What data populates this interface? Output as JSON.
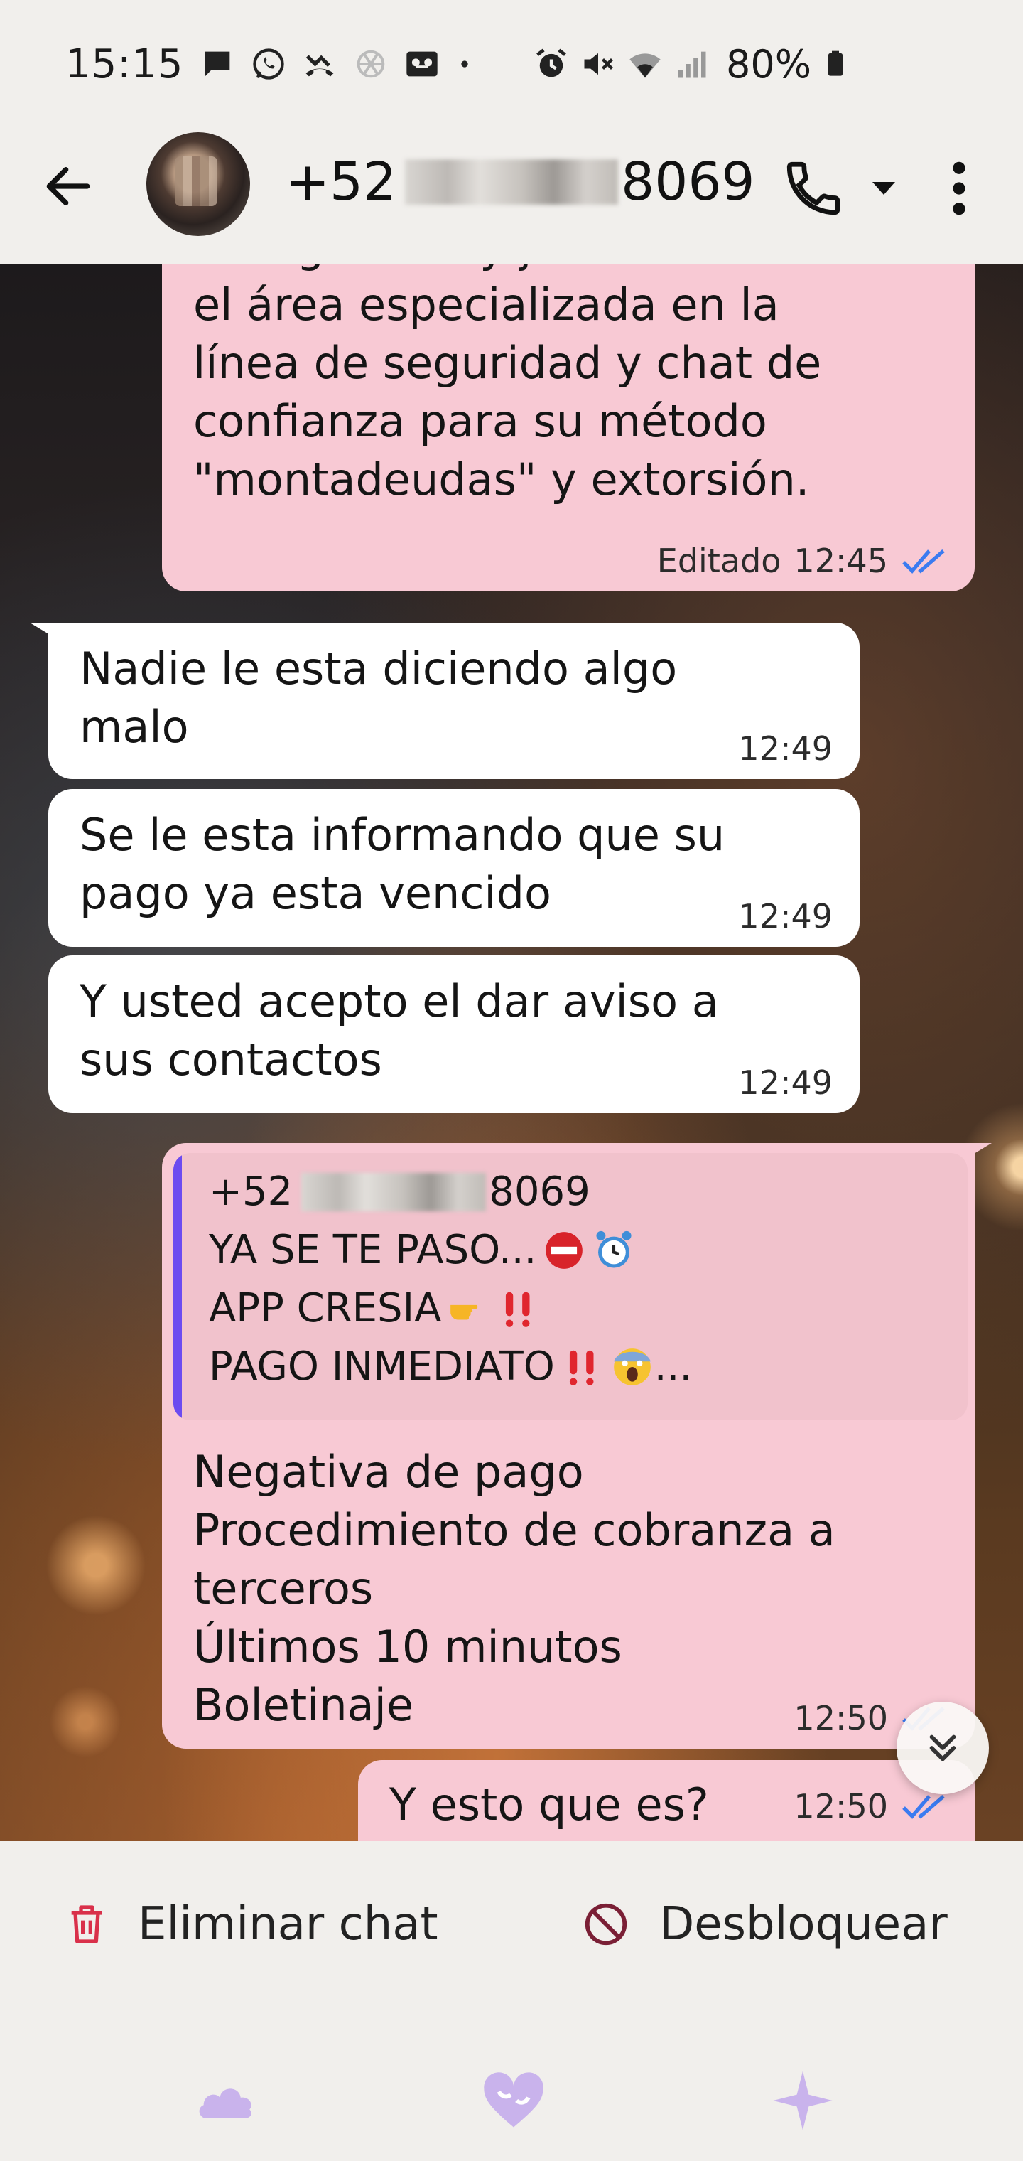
{
  "status_bar": {
    "time": "15:15",
    "battery": "80%",
    "left_icons": [
      "messages-icon",
      "whatsapp-icon",
      "missed-call-icon",
      "chatgpt-icon",
      "voicemail-icon",
      "dot-icon"
    ],
    "right_icons": [
      "alarm-icon",
      "mute-icon",
      "wifi-icon",
      "signal-icon",
      "battery-icon"
    ]
  },
  "header": {
    "contact_prefix": "+52",
    "contact_suffix": "8069",
    "icons": [
      "back-arrow-icon",
      "phone-icon",
      "chevron-down-icon",
      "more-vert-icon"
    ]
  },
  "messages": [
    {
      "direction": "out",
      "text": "la seguridad y justicia. En\nel área especializada en la\nlínea de seguridad y chat de\nconfianza para su método\n\"montadeudas\" y extorsión.",
      "edited_label": "Editado",
      "time": "12:45"
    },
    {
      "direction": "in",
      "text": "Nadie le esta diciendo algo\nmalo",
      "time": "12:49"
    },
    {
      "direction": "in",
      "text": "Se le esta informando que su\npago ya esta vencido",
      "time": "12:49"
    },
    {
      "direction": "in",
      "text": "Y usted acepto el dar aviso a\nsus contactos",
      "time": "12:49"
    },
    {
      "direction": "out",
      "quote": {
        "sender_prefix": "+52",
        "sender_suffix": "8069",
        "lines": [
          "YA SE TE PASO...",
          "APP CRESIA",
          "PAGO INMEDIATO"
        ],
        "line_suffix": "..."
      },
      "text": "Negativa de pago\nProcedimiento de cobranza a\nterceros\nÚltimos 10 minutos\nBoletinaje",
      "time": "12:50"
    },
    {
      "direction": "out",
      "text": "Y esto que es?",
      "time": "12:50"
    }
  ],
  "actions": {
    "delete_label": "Eliminar chat",
    "unblock_label": "Desbloquear"
  },
  "colors": {
    "outgoing_bubble": "#f8c9d4",
    "incoming_bubble": "#ffffff",
    "quote_bar": "#6c4bf0",
    "read_ticks": "#3b7bf0",
    "delete_icon": "#d9304a",
    "unblock_icon": "#7a1f35",
    "nav_icons": "#c9b3ec"
  }
}
